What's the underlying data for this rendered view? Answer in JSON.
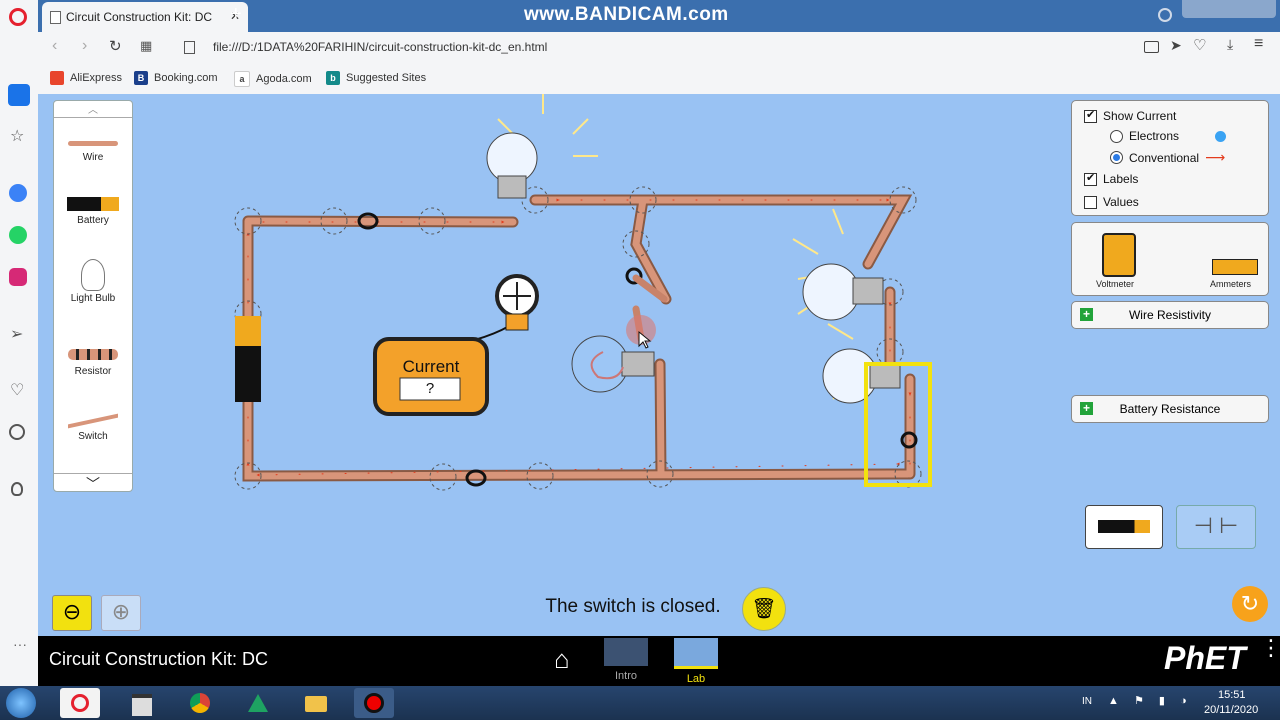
{
  "browser": {
    "watermark": "www.BANDICAM.com",
    "tab_title": "Circuit Construction Kit: DC",
    "tab_close": "✕",
    "new_tab": "+",
    "url": "file:///D:/1DATA%20FARIHIN/circuit-construction-kit-dc_en.html",
    "bookmarks": [
      "AliExpress",
      "Booking.com",
      "Agoda.com",
      "Suggested Sites"
    ]
  },
  "toolbox": {
    "items": [
      {
        "label": "Wire",
        "icon": "wire-icon"
      },
      {
        "label": "Battery",
        "icon": "battery-icon"
      },
      {
        "label": "Light Bulb",
        "icon": "light-bulb-icon"
      },
      {
        "label": "Resistor",
        "icon": "resistor-icon"
      },
      {
        "label": "Switch",
        "icon": "switch-icon"
      }
    ]
  },
  "options_panel": {
    "show_current": "Show Current",
    "show_current_checked": true,
    "electrons": "Electrons",
    "conventional": "Conventional",
    "selected_mode": "Conventional",
    "labels": "Labels",
    "labels_checked": true,
    "values": "Values",
    "values_checked": false
  },
  "meters": {
    "voltmeter": "Voltmeter",
    "ammeter": "Ammeters"
  },
  "wire_resistivity": "Wire Resistivity",
  "battery_resistance": "Battery Resistance",
  "ammeter_probe": {
    "title": "Current",
    "value": "?"
  },
  "status_message": "The switch is closed.",
  "sim_title": "Circuit Construction Kit: DC",
  "screens": [
    {
      "label": "Intro"
    },
    {
      "label": "Lab"
    }
  ],
  "brand": "PhET",
  "clock": {
    "time": "15:51",
    "date": "20/11/2020",
    "lang": "IN"
  },
  "colors": {
    "sim_bg": "#99c2f3",
    "wire": "#d8957a",
    "current_arrow": "#e33b1d",
    "accent_yellow": "#f2d50f"
  }
}
